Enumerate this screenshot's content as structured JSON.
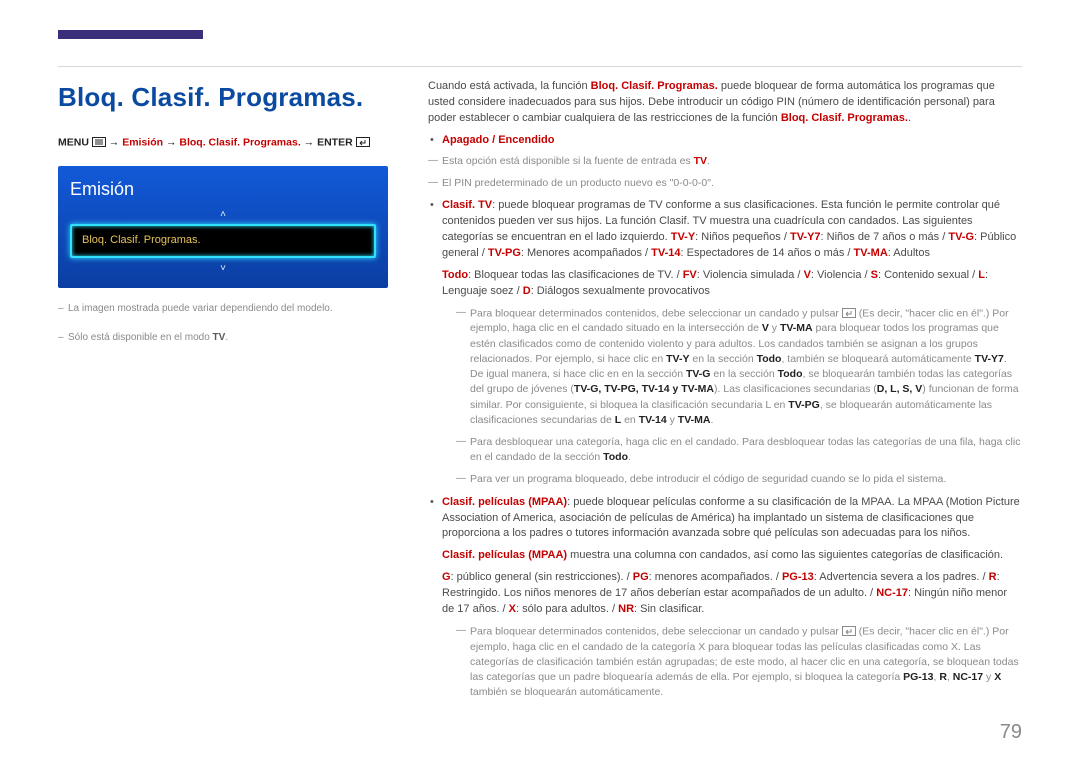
{
  "page_number": "79",
  "title": "Bloq. Clasif. Programas.",
  "nav": {
    "menu": "MENU",
    "arrow": "→",
    "p1": "Emisión",
    "p2": "Bloq. Clasif. Programas.",
    "enter": "ENTER"
  },
  "osd": {
    "header": "Emisión",
    "item": "Bloq. Clasif. Programas.",
    "up": "˄",
    "down": "˅"
  },
  "footnotes": {
    "f1": "La imagen mostrada puede variar dependiendo del modelo.",
    "f2_pre": "Sólo está disponible en el modo ",
    "f2_tv": "TV",
    "f2_post": "."
  },
  "body": {
    "intro_a": "Cuando está activada, la función ",
    "intro_b": "Bloq. Clasif. Programas.",
    "intro_c": " puede bloquear de forma automática los programas que usted considere inadecuados para sus hijos. Debe introducir un código PIN (número de identificación personal) para poder establecer o cambiar cualquiera de las restricciones de la función ",
    "intro_d": "Bloq. Clasif. Programas.",
    "intro_e": ".",
    "onoff": "Apagado / Encendido",
    "note_tv_a": "Esta opción está disponible si la fuente de entrada es ",
    "note_tv_b": "TV",
    "note_tv_c": ".",
    "note_pin": "El PIN predeterminado de un producto nuevo es \"0-0-0-0\".",
    "clasif_tv_lead": "Clasif. TV",
    "clasif_tv_body_a": ": puede bloquear programas de TV conforme a sus clasificaciones. Esta función le permite controlar qué contenidos pueden ver sus hijos. La función Clasif. TV muestra una cuadrícula con candados. Las siguientes categorías se encuentran en el lado izquierdo. ",
    "tvy": "TV-Y",
    "tvy_d": ": Niños pequeños / ",
    "tvy7": "TV-Y7",
    "tvy7_d": ": Niños de 7 años o más / ",
    "tvg": "TV-G",
    "tvg_d": ": Público general / ",
    "tvpg": "TV-PG",
    "tvpg_d": ": Menores acompañados / ",
    "tv14": "TV-14",
    "tv14_d": ": Espectadores de 14 años o más / ",
    "tvma": "TV-MA",
    "tvma_d": ": Adultos",
    "todo": "Todo",
    "todo_d": ": Bloquear todas las clasificaciones de TV. / ",
    "fv": "FV",
    "fv_d": ": Violencia simulada / ",
    "v": "V",
    "v_d": ": Violencia / ",
    "s": "S",
    "s_d": ": Contenido sexual / ",
    "l": "L",
    "l_d": ": Lenguaje soez / ",
    "d": "D",
    "d_d": ": Diálogos sexualmente provocativos",
    "blocknote_a": "Para bloquear determinados contenidos, debe seleccionar un candado y pulsar ",
    "blocknote_b": " (Es decir, \"hacer clic en él\".) Por ejemplo, haga clic en el candado situado en la intersección de ",
    "blocknote_c": " y ",
    "blocknote_d": " para bloquear todos los programas que estén clasificados como de contenido violento y para adultos. Los candados también se asignan a los grupos relacionados. Por ejemplo, si hace clic en ",
    "blocknote_e": " en la sección ",
    "blocknote_f": ", también se bloqueará automáticamente ",
    "blocknote_g": ". De igual manera, si hace clic en ",
    "blocknote_h": " en la sección ",
    "blocknote_i": ", se bloquearán también todas las categorías del grupo de jóvenes (",
    "blocknote_j": "). Las clasificaciones secundarias (",
    "blocknote_k": ") funcionan de forma similar. Por consiguiente, si bloquea la clasificación secundaria L en ",
    "blocknote_l": ", se bloquearán automáticamente las clasificaciones secundarias de ",
    "blocknote_m": " en ",
    "blocknote_n": " y ",
    "blocknote_o": ".",
    "V": "V",
    "TVMA": "TV-MA",
    "TVY": "TV-Y",
    "Todo": "Todo",
    "TVY7": "TV-Y7",
    "TVG": "TV-G",
    "grp": "TV-G, TV-PG, TV-14 y TV-MA",
    "dlsv": "D, L, S, V",
    "TVPG": "TV-PG",
    "L": "L",
    "TV14": "TV-14",
    "y": " y ",
    "unblock_a": "Para desbloquear una categoría, haga clic en el candado. Para desbloquear todas las categorías de una fila, haga clic en el candado de la sección ",
    "unblock_b": "Todo",
    "unblock_c": ".",
    "viewblocked": "Para ver un programa bloqueado, debe introducir el código de seguridad cuando se lo pida el sistema.",
    "mpaa_lead": "Clasif. películas (MPAA)",
    "mpaa_body": ": puede bloquear películas conforme a su clasificación de la MPAA. La MPAA (Motion Picture Association of America, asociación de películas de América) ha implantado un sistema de clasificaciones que proporciona a los padres o tutores información avanzada sobre qué películas son adecuadas para los niños.",
    "mpaa_col_a": "Clasif. películas (MPAA)",
    "mpaa_col_b": " muestra una columna con candados, así como las siguientes categorías de clasificación.",
    "G": "G",
    "G_d": ": público general (sin restricciones). / ",
    "PG": "PG",
    "PG_d": ": menores acompañados. / ",
    "PG13": "PG-13",
    "PG13_d": ": Advertencia severa a los padres. / ",
    "R": "R",
    "R_d": ": Restringido. Los niños menores de 17 años deberían estar acompañados de un adulto. / ",
    "NC17": "NC-17",
    "NC17_d": ": Ningún niño menor de 17 años. / ",
    "X": "X",
    "X_d": ": sólo para adultos. / ",
    "NR": "NR",
    "NR_d": ": Sin clasificar.",
    "mpaa_note_a": "Para bloquear determinados contenidos, debe seleccionar un candado y pulsar ",
    "mpaa_note_b": " (Es decir, \"hacer clic en él\".) Por ejemplo, haga clic en el candado de la categoría X para bloquear todas las películas clasificadas como X. Las categorías de clasificación también están agrupadas; de este modo, al hacer clic en una categoría, se bloquean todas las categorías que un padre bloquearía además de ella. Por ejemplo, si bloquea la categoría ",
    "mpaa_note_c": " también se bloquearán automáticamente.",
    "PG13b": "PG-13",
    "Rb": "R",
    "NC17b": "NC-17",
    "Xb": "X",
    "sep": ", "
  }
}
